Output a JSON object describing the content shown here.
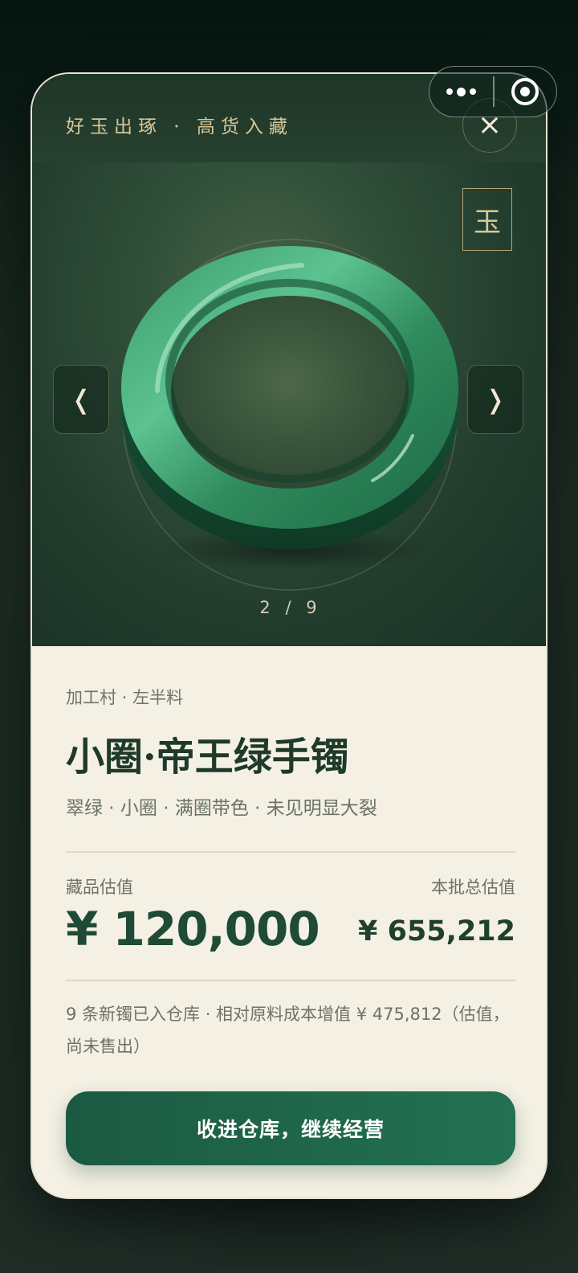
{
  "header": {
    "tagline": "好玉出琢 · 高货入藏",
    "close_icon": "×",
    "seal_char": "玉"
  },
  "gallery": {
    "prev_icon": "❬",
    "next_icon": "❭",
    "current": 2,
    "total": 9,
    "pager_text": "2 / 9"
  },
  "item": {
    "origin": "加工村 · 左半料",
    "title": "小圈·帝王绿手镯",
    "tags": "翠绿 · 小圈 · 满圈带色 · 未见明显大裂"
  },
  "valuation": {
    "item_label": "藏品估值",
    "item_value": "¥ 120,000",
    "batch_label": "本批总估值",
    "batch_value": "¥ 655,212"
  },
  "summary": {
    "text": "9 条新镯已入仓库 · 相对原料成本增值 ¥ 475,812（估值，尚未售出）"
  },
  "actions": {
    "cta_label": "收进仓库，继续经营"
  },
  "colors": {
    "accent": "#1f5b43",
    "gold": "#d6c898",
    "jade": "#3fa773",
    "paper": "#f4f0e4"
  },
  "icons": {
    "capsule_more": "more-dots-icon",
    "capsule_close": "target-icon",
    "close": "close-icon",
    "prev": "chevron-left-icon",
    "next": "chevron-right-icon"
  }
}
